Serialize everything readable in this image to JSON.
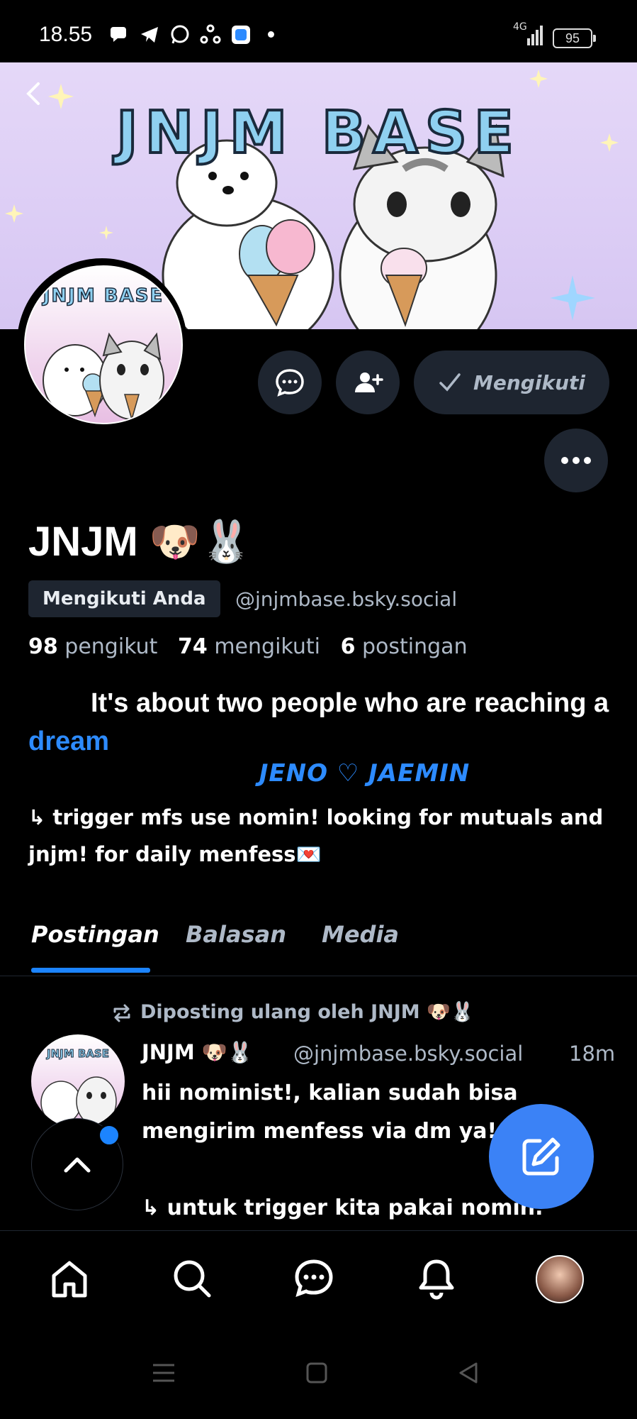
{
  "status_bar": {
    "time": "18.55",
    "network": "4G",
    "battery": "95"
  },
  "profile": {
    "banner_title": "JNJM BASE",
    "avatar_title": "JNJM BASE",
    "display_name": "JNJM 🐶🐰",
    "follows_you_label": "Mengikuti Anda",
    "handle": "@jnjmbase.bsky.social",
    "stats": {
      "followers_count": "98",
      "followers_label": "pengikut",
      "following_count": "74",
      "following_label": "mengikuti",
      "posts_count": "6",
      "posts_label": "postingan"
    },
    "bio": {
      "line1_prefix": "It's about two people who are reaching a ",
      "line1_highlight": "dream",
      "line2": "JENO ♡ JAEMIN",
      "line3": "↳ trigger mfs use nomin! looking for mutuals and jnjm! for daily menfess💌"
    }
  },
  "actions": {
    "follow_label": "Mengikuti"
  },
  "tabs": [
    {
      "label": "Postingan",
      "active": true
    },
    {
      "label": "Balasan",
      "active": false
    },
    {
      "label": "Media",
      "active": false
    }
  ],
  "post": {
    "repost_label": "Diposting ulang oleh JNJM 🐶🐰",
    "author_name": "JNJM 🐶🐰",
    "author_handle": "@jnjmbase.bsky.social",
    "time": "18m",
    "avatar_title": "JNJM BASE",
    "text": "hii nominist!,  kalian sudah bisa\nmengirim menfess via dm ya!.\n\n↳ untuk trigger kita pakai nomin."
  },
  "colors": {
    "accent": "#1c84ff",
    "compose": "#3b82f6",
    "muted_text": "#aeb9c7",
    "chip_bg": "#1e2530"
  }
}
